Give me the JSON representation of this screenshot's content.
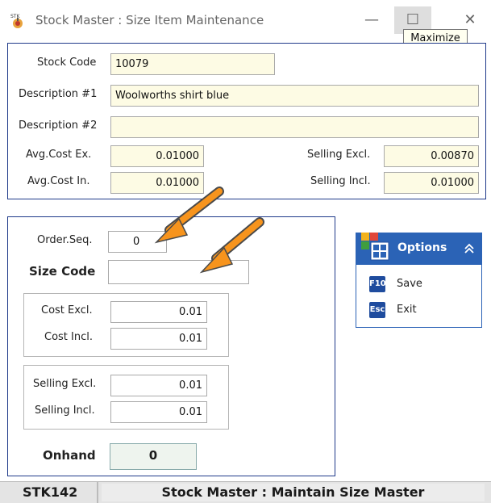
{
  "window": {
    "title": "Stock Master : Size Item Maintenance",
    "minimize_glyph": "—",
    "maximize_glyph": "☐",
    "close_glyph": "✕",
    "maximize_tooltip": "Maximize"
  },
  "stock_header": {
    "stock_code_label": "Stock Code",
    "stock_code_value": "10079",
    "description1_label": "Description #1",
    "description1_value": "Woolworths shirt blue",
    "description2_label": "Description #2",
    "description2_value": "",
    "avg_cost_ex_label": "Avg.Cost Ex.",
    "avg_cost_ex_value": "0.01000",
    "avg_cost_in_label": "Avg.Cost In.",
    "avg_cost_in_value": "0.01000",
    "selling_excl_label": "Selling Excl.",
    "selling_excl_value": "0.00870",
    "selling_incl_label": "Selling Incl.",
    "selling_incl_value": "0.01000"
  },
  "size_form": {
    "order_seq_label": "Order.Seq.",
    "order_seq_value": "0",
    "size_code_label": "Size Code",
    "size_code_value": "",
    "cost_excl_label": "Cost Excl.",
    "cost_excl_value": "0.01",
    "cost_incl_label": "Cost Incl.",
    "cost_incl_value": "0.01",
    "selling_excl_label": "Selling Excl.",
    "selling_excl_value": "0.01",
    "selling_incl_label": "Selling Incl.",
    "selling_incl_value": "0.01",
    "onhand_label": "Onhand",
    "onhand_value": "0"
  },
  "options": {
    "title": "Options",
    "items": [
      {
        "key": "F10",
        "label": "Save",
        "icon": "f10-key-icon"
      },
      {
        "key": "Esc",
        "label": "Exit",
        "icon": "esc-key-icon"
      }
    ]
  },
  "status_bar": {
    "code": "STK142",
    "text": "Stock Master : Maintain Size Master"
  },
  "colors": {
    "accent": "#2b63b6",
    "box_border": "#1f3a8a",
    "field_background": "#fdfbe4",
    "annotation_arrow": "#f7941d"
  }
}
